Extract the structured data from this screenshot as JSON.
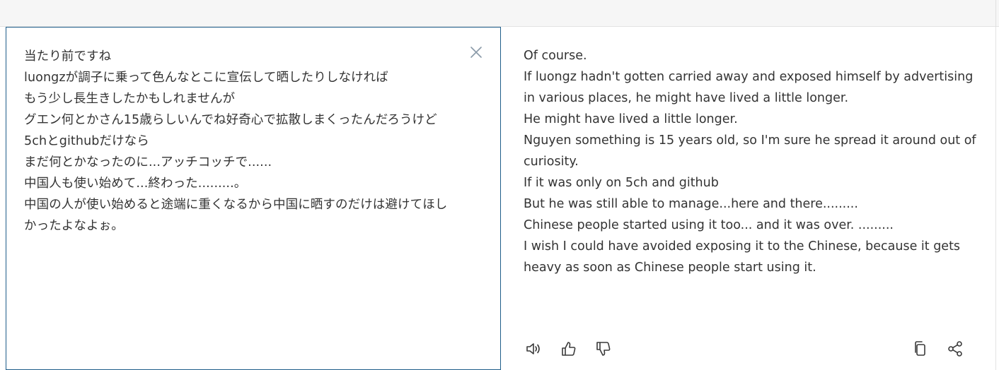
{
  "source": {
    "lines": [
      "当たり前ですね",
      "luongzが調子に乗って色んなとこに宣伝して晒したりしなければ",
      "もう少し長生きしたかもしれませんが",
      "グエン何とかさん15歳らしいんでね好奇心で拡散しまくったんだろうけど",
      "5chとgithubだけなら",
      "まだ何とかなったのに...アッチコッチで......",
      "中国人も使い始めて...終わった.........。",
      "中国の人が使い始めると途端に重くなるから中国に晒すのだけは避けてほしかったよなよぉ。"
    ]
  },
  "target": {
    "lines": [
      "Of course.",
      "If luongz hadn't gotten carried away and exposed himself by advertising in various places, he might have lived a little longer.",
      "He might have lived a little longer.",
      "Nguyen something is 15 years old, so I'm sure he spread it around out of curiosity.",
      "If it was only on 5ch and github",
      "But he was still able to manage...here and there.........",
      "Chinese people started using it too... and it was over. .........",
      "I wish I could have avoided exposing it to the Chinese, because it gets heavy as soon as Chinese people start using it."
    ]
  },
  "icons": {
    "clear": "close-icon",
    "listen": "speaker-icon",
    "like": "thumbs-up-icon",
    "dislike": "thumbs-down-icon",
    "copy": "copy-icon",
    "share": "share-icon"
  },
  "colors": {
    "focus_border": "#1f5d8a",
    "text": "#333333",
    "icon": "#3a3a3a",
    "top_bar": "#f6f6f6"
  }
}
